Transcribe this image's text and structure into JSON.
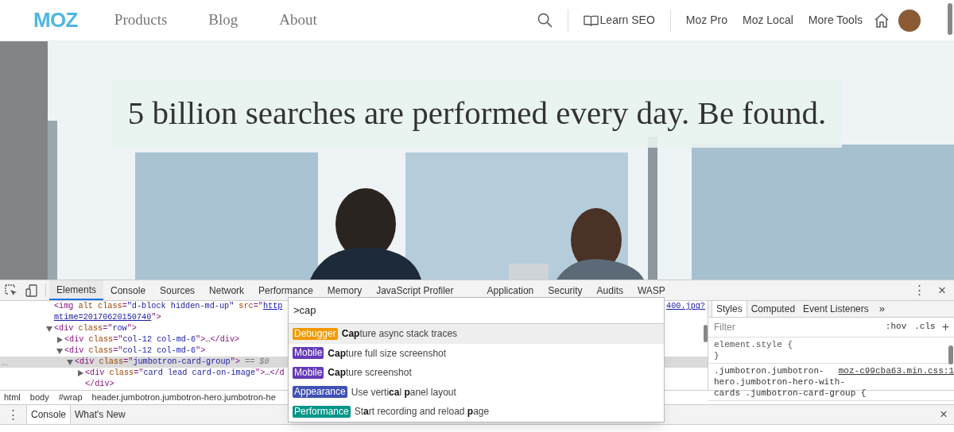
{
  "nav": {
    "logo": "MOZ",
    "links": [
      "Products",
      "Blog",
      "About"
    ],
    "learn": "Learn SEO",
    "right_links": [
      "Moz Pro",
      "Moz Local",
      "More Tools"
    ]
  },
  "hero": {
    "headline": "5 billion searches are performed every day. Be found."
  },
  "devtools": {
    "tabs": [
      {
        "label": "Elements",
        "selected": true
      },
      {
        "label": "Console",
        "selected": false
      },
      {
        "label": "Sources",
        "selected": false
      },
      {
        "label": "Network",
        "selected": false
      },
      {
        "label": "Performance",
        "selected": false
      },
      {
        "label": "Memory",
        "selected": false
      },
      {
        "label": "JavaScript Profiler",
        "selected": false
      },
      {
        "label": "Application",
        "selected": false
      },
      {
        "label": "Security",
        "selected": false
      },
      {
        "label": "Audits",
        "selected": false
      },
      {
        "label": "WASP",
        "selected": false
      }
    ],
    "menu": "⋮",
    "close": "×",
    "elements": {
      "gutter": "...",
      "trailing_link": "400.jpg?",
      "nodes": [
        {
          "selected": false,
          "parts": [
            {
              "kind": "tag",
              "t": "<img"
            },
            {
              "kind": "attr",
              "t": " alt"
            },
            {
              "kind": "attr",
              "t": " class"
            },
            {
              "kind": "tag",
              "t": "="
            },
            {
              "kind": "val",
              "t": "\"d-block hidden-md-up\""
            },
            {
              "kind": "attr",
              "t": " src"
            },
            {
              "kind": "tag",
              "t": "="
            },
            {
              "kind": "tag",
              "t": "\""
            },
            {
              "kind": "link",
              "t": "http"
            }
          ]
        },
        {
          "selected": false,
          "parts": [
            {
              "kind": "link",
              "t": "mtime=20170620150740"
            },
            {
              "kind": "tag",
              "t": "\">"
            }
          ]
        },
        {
          "selected": false,
          "expanded": true,
          "parts": [
            {
              "kind": "tag",
              "t": "<div"
            },
            {
              "kind": "attr",
              "t": " class"
            },
            {
              "kind": "tag",
              "t": "=\""
            },
            {
              "kind": "val",
              "t": "row"
            },
            {
              "kind": "tag",
              "t": "\">"
            }
          ],
          "children": [
            {
              "selected": false,
              "expanded": false,
              "parts": [
                {
                  "kind": "tag",
                  "t": "<div"
                },
                {
                  "kind": "attr",
                  "t": " class"
                },
                {
                  "kind": "tag",
                  "t": "=\""
                },
                {
                  "kind": "val",
                  "t": "col-12 col-md-6"
                },
                {
                  "kind": "tag",
                  "t": "\">"
                },
                {
                  "kind": "text",
                  "t": "…"
                },
                {
                  "kind": "tag",
                  "t": "</div>"
                }
              ]
            },
            {
              "selected": false,
              "expanded": true,
              "parts": [
                {
                  "kind": "tag",
                  "t": "<div"
                },
                {
                  "kind": "attr",
                  "t": " class"
                },
                {
                  "kind": "tag",
                  "t": "=\""
                },
                {
                  "kind": "val",
                  "t": "col-12 col-md-6"
                },
                {
                  "kind": "tag",
                  "t": "\">"
                }
              ],
              "children": [
                {
                  "selected": true,
                  "expanded": true,
                  "parts": [
                    {
                      "kind": "tag",
                      "t": "<div"
                    },
                    {
                      "kind": "attr",
                      "t": " class"
                    },
                    {
                      "kind": "tag",
                      "t": "=\""
                    },
                    {
                      "kind": "val",
                      "t": "jumbotron-card-group"
                    },
                    {
                      "kind": "tag",
                      "t": "\">"
                    },
                    {
                      "kind": "note",
                      "t": " == $0"
                    }
                  ],
                  "children": [
                    {
                      "selected": false,
                      "expanded": false,
                      "parts": [
                        {
                          "kind": "tag",
                          "t": "<div"
                        },
                        {
                          "kind": "attr",
                          "t": " class"
                        },
                        {
                          "kind": "tag",
                          "t": "=\""
                        },
                        {
                          "kind": "val",
                          "t": "card lead card-on-image"
                        },
                        {
                          "kind": "tag",
                          "t": "\">"
                        },
                        {
                          "kind": "text",
                          "t": "…"
                        },
                        {
                          "kind": "tag",
                          "t": "</d"
                        }
                      ]
                    },
                    {
                      "selected": false,
                      "parts": [
                        {
                          "kind": "tag",
                          "t": "</div>"
                        }
                      ]
                    }
                  ]
                }
              ]
            }
          ]
        }
      ]
    },
    "breadcrumbs": [
      "html",
      "body",
      "#wrap",
      "header.jumbotron.jumbotron-hero.jumbotron-he"
    ],
    "styles": {
      "tabs": [
        {
          "label": "Styles",
          "selected": true
        },
        {
          "label": "Computed",
          "selected": false
        },
        {
          "label": "Event Listeners",
          "selected": false
        }
      ],
      "more": "»",
      "filter": {
        "placeholder": "Filter"
      },
      "hov": ":hov",
      "cls": ".cls",
      "add": "+",
      "rules": [
        {
          "lines": [
            "element.style {",
            "}"
          ]
        },
        {
          "lines": [
            ".jumbotron.jumbotron-",
            "hero.jumbotron-hero-with-",
            "cards .jumbotron-card-group {"
          ],
          "source": "moz-c99cba63.min.css:1"
        }
      ]
    },
    "drawer": {
      "menu": "⋮",
      "tabs": [
        {
          "label": "Console",
          "selected": true
        },
        {
          "label": "What's New",
          "selected": false
        }
      ],
      "close": "×"
    },
    "palette": {
      "value": ">cap",
      "items": [
        {
          "category": "Debugger",
          "color": "#f29900",
          "title": "**Cap**ture async stack traces",
          "selected": true
        },
        {
          "category": "Mobile",
          "color": "#673ab7",
          "title": "**Cap**ture full size screenshot",
          "selected": false
        },
        {
          "category": "Mobile",
          "color": "#673ab7",
          "title": "**Cap**ture screenshot",
          "selected": false
        },
        {
          "category": "Appearance",
          "color": "#3f51b5",
          "title": "Use verti**ca**l **p**anel layout",
          "selected": false
        },
        {
          "category": "Performance",
          "color": "#009688",
          "title": "St**a**rt recording and reload **p**age",
          "selected": false
        }
      ]
    }
  }
}
